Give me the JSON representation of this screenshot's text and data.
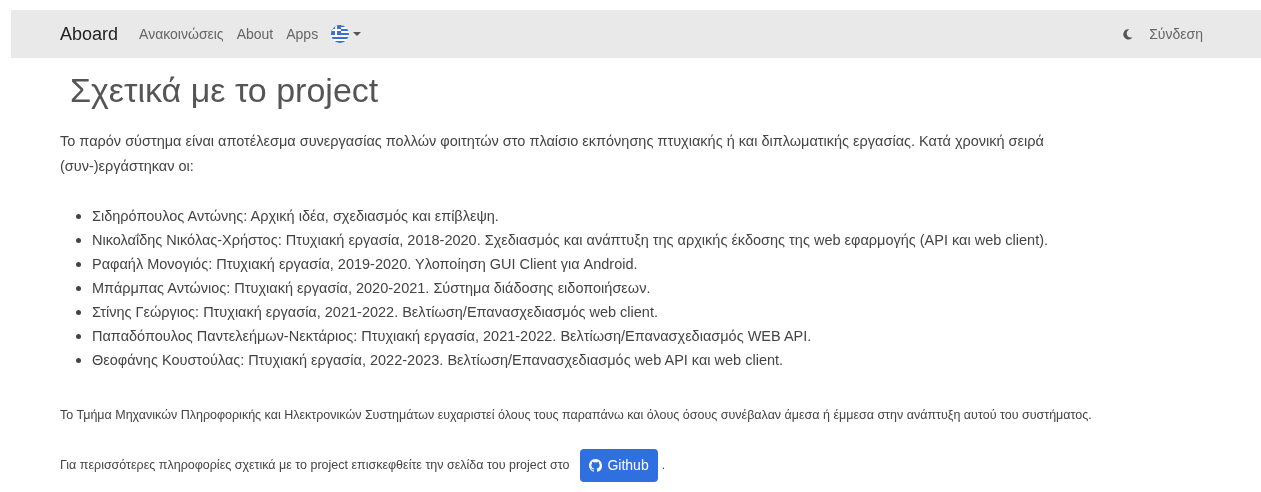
{
  "navbar": {
    "brand": "Aboard",
    "links": [
      {
        "label": "Ανακοινώσεις"
      },
      {
        "label": "About"
      },
      {
        "label": "Apps"
      }
    ],
    "login": "Σύνδεση"
  },
  "heading": "Σχετικά με το project",
  "intro": "Το παρόν σύστημα είναι αποτέλεσμα συνεργασίας πολλών φοιτητών στο πλαίσιο εκπόνησης πτυχιακής ή και διπλωματικής εργασίας. Κατά χρονική σειρά (συν-)εργάστηκαν οι:",
  "contributors": [
    "Σιδηρόπουλος Αντώνης: Αρχική ιδέα, σχεδιασμός και επίβλεψη.",
    "Νικολαΐδης Νικόλας-Χρήστος: Πτυχιακή εργασία, 2018-2020. Σχεδιασμός και ανάπτυξη της αρχικής έκδοσης της web εφαρμογής (API και web client).",
    "Ραφαήλ Μονογιός: Πτυχιακή εργασία, 2019-2020. Υλοποίηση GUI Client για Android.",
    "Μπάρμπας Αντώνιος: Πτυχιακή εργασία, 2020-2021. Σύστημα διάδοσης ειδοποιήσεων.",
    "Στίνης Γεώργιος: Πτυχιακή εργασία, 2021-2022. Βελτίωση/Επανασχεδιασμός web client.",
    "Παπαδόπουλος Παντελεήμων-Νεκτάριος: Πτυχιακή εργασία, 2021-2022. Βελτίωση/Επανασχεδιασμός WEB API.",
    "Θεοφάνης Κουστούλας: Πτυχιακή εργασία, 2022-2023. Βελτίωση/Επανασχεδιασμός web API και web client."
  ],
  "thanks": "Το Τμήμα Μηχανικών Πληροφορικής και Ηλεκτρονικών Συστημάτων ευχαριστεί όλους τους παραπάνω και όλους όσους συνέβαλαν άμεσα ή έμμεσα στην ανάπτυξη αυτού του συστήματος.",
  "more_info": {
    "text": "Για περισσότερες πληροφορίες σχετικά με το project επισκεφθείτε την σελίδα του project στο",
    "button": "Github",
    "end": "."
  }
}
